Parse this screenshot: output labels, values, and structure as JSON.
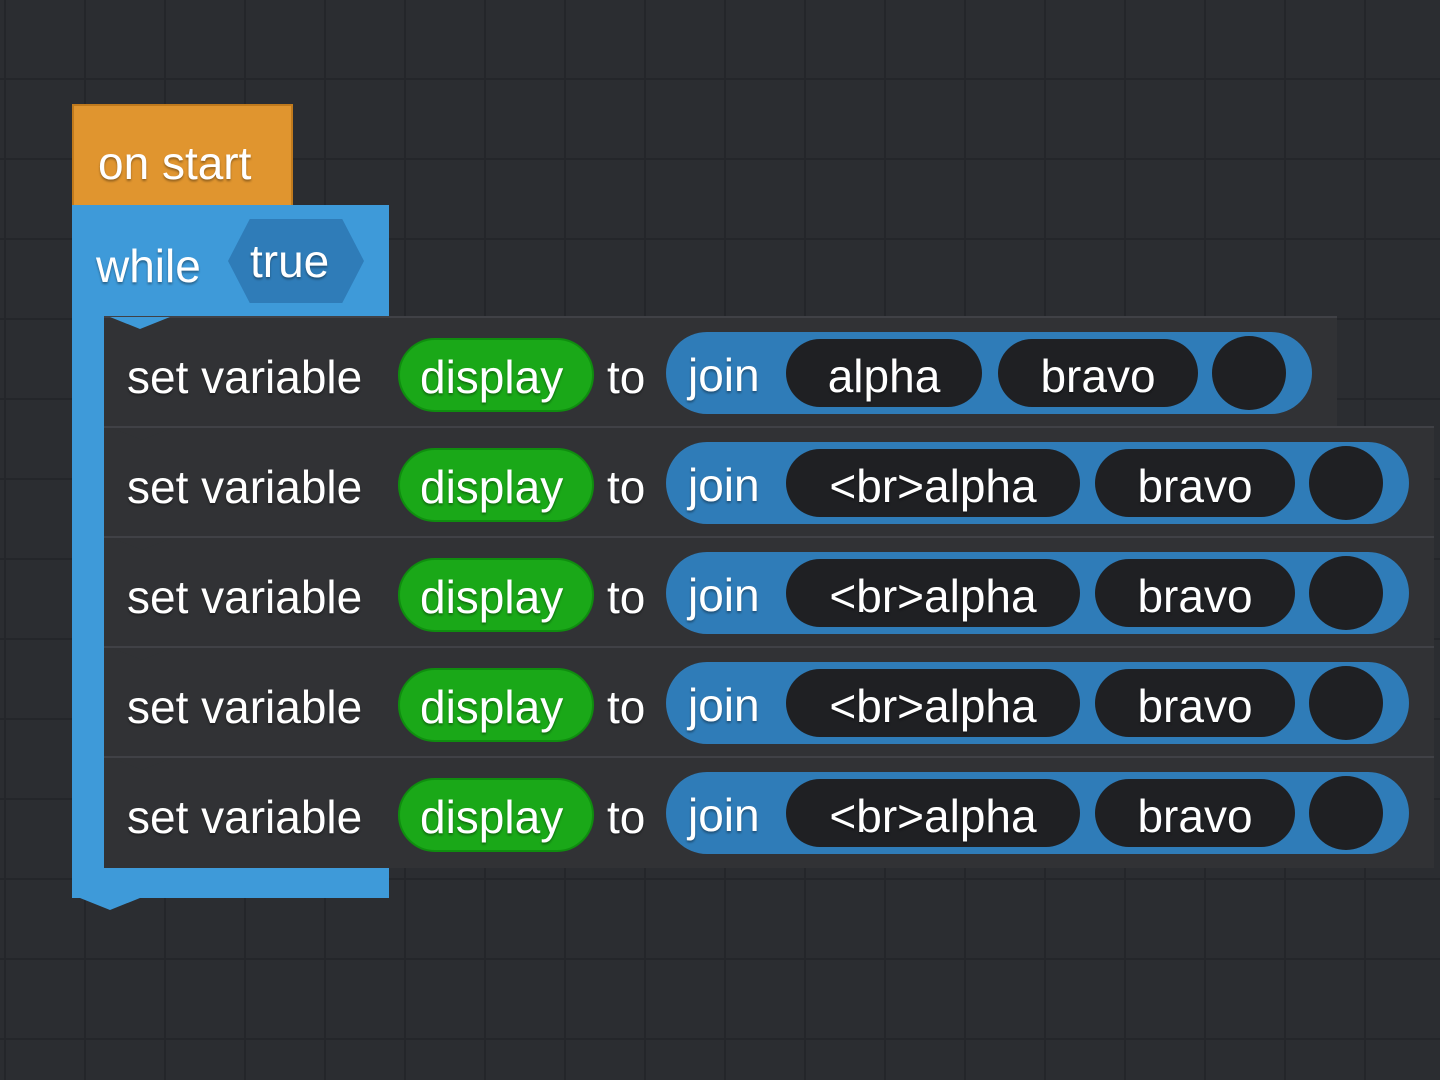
{
  "colors": {
    "event": "#e0952f",
    "loop": "#3e9ad9",
    "variable": "#1aa818",
    "text_join": "#2f7cb8",
    "statement": "#313235",
    "slot": "#1f2023"
  },
  "on_start": {
    "label": "on start"
  },
  "while_block": {
    "label": "while",
    "condition": "true"
  },
  "rows": [
    {
      "label": "set variable",
      "variable": "display",
      "to": "to",
      "join": "join",
      "item1": "alpha",
      "item2": "bravo"
    },
    {
      "label": "set variable",
      "variable": "display",
      "to": "to",
      "join": "join",
      "item1": "<br>alpha",
      "item2": "bravo"
    },
    {
      "label": "set variable",
      "variable": "display",
      "to": "to",
      "join": "join",
      "item1": "<br>alpha",
      "item2": "bravo"
    },
    {
      "label": "set variable",
      "variable": "display",
      "to": "to",
      "join": "join",
      "item1": "<br>alpha",
      "item2": "bravo"
    },
    {
      "label": "set variable",
      "variable": "display",
      "to": "to",
      "join": "join",
      "item1": "<br>alpha",
      "item2": "bravo"
    }
  ]
}
